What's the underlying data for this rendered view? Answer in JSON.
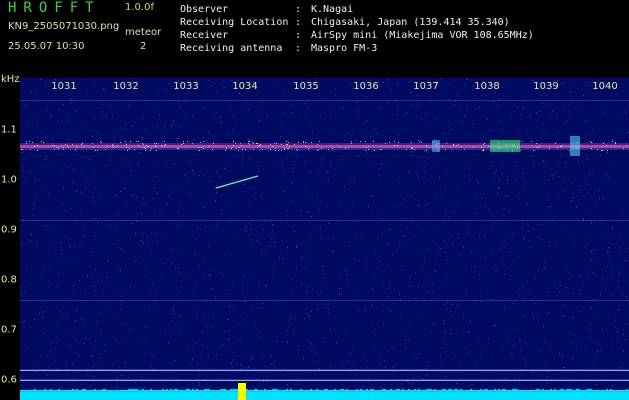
{
  "app": {
    "title": "HROFFT",
    "version": "1.0.0f",
    "filename": "KN9_2505071030.png",
    "meteor_label": "meteor",
    "datetime": "25.05.07 10:30",
    "meteor_count": "2"
  },
  "info": [
    {
      "key": "Observer",
      "value": "K.Nagai"
    },
    {
      "key": "Receiving Location",
      "value": "Chigasaki, Japan (139.414 35.340)"
    },
    {
      "key": "Receiver",
      "value": "AirSpy mini (Miakejima VOR 108.65MHz)"
    },
    {
      "key": "Receiving antenna",
      "value": "Maspro FM-3"
    }
  ],
  "axes": {
    "y_unit": "kHz",
    "x_ticks": [
      "1031",
      "1032",
      "1033",
      "1034",
      "1035",
      "1036",
      "1037",
      "1038",
      "1039",
      "1040"
    ],
    "y_ticks": [
      "1.1",
      "1.0",
      "0.9",
      "0.8",
      "0.7",
      "0.6"
    ]
  },
  "colors": {
    "background": "#000000",
    "plot_background": "#000a60",
    "title_green": "#3ad23a",
    "label_yellow": "#d8d860",
    "carrier": "#ff4060",
    "baseline": "#00e0ff",
    "burst": "#ffff00"
  }
}
